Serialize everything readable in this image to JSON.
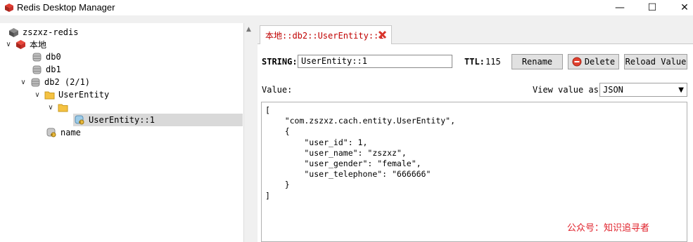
{
  "window": {
    "title": "Redis Desktop Manager",
    "controls": {
      "minimize": "—",
      "maximize": "☐",
      "close": "✕"
    }
  },
  "tree": {
    "nodes": [
      {
        "label": "zszxz-redis",
        "toggle": "",
        "icon": "server-icon-gray"
      },
      {
        "label": "本地",
        "toggle": "∨",
        "icon": "server-icon-red"
      },
      {
        "label": "db0",
        "toggle": "",
        "icon": "database-icon"
      },
      {
        "label": "db1",
        "toggle": "",
        "icon": "database-icon"
      },
      {
        "label": "db2  (2/1)",
        "toggle": "∨",
        "icon": "database-icon"
      },
      {
        "label": "UserEntity",
        "toggle": "∨",
        "icon": "folder-icon"
      },
      {
        "label": "",
        "toggle": "∨",
        "icon": "folder-icon"
      },
      {
        "label": "UserEntity::1",
        "toggle": "",
        "icon": "key-icon",
        "selected": true
      },
      {
        "label": "name",
        "toggle": "",
        "icon": "key-icon"
      }
    ]
  },
  "tab": {
    "label": "本地::db2::UserEntity::1"
  },
  "key_info": {
    "type_label": "STRING:",
    "key_value": "UserEntity::1",
    "ttl_label": "TTL:",
    "ttl_value": "115",
    "rename": "Rename",
    "delete": "Delete",
    "reload": "Reload Value"
  },
  "value_area": {
    "value_label": "Value:",
    "view_as_label": "View value as:",
    "view_as_selected": "JSON",
    "content": "[\n    \"com.zszxz.cach.entity.UserEntity\",\n    {\n        \"user_id\": 1,\n        \"user_name\": \"zszxz\",\n        \"user_gender\": \"female\",\n        \"user_telephone\": \"666666\"\n    }\n]"
  },
  "watermark": "公众号：知识追寻者",
  "colors": {
    "accent_red": "#c00000",
    "selected_bg": "#d9d9d9"
  }
}
